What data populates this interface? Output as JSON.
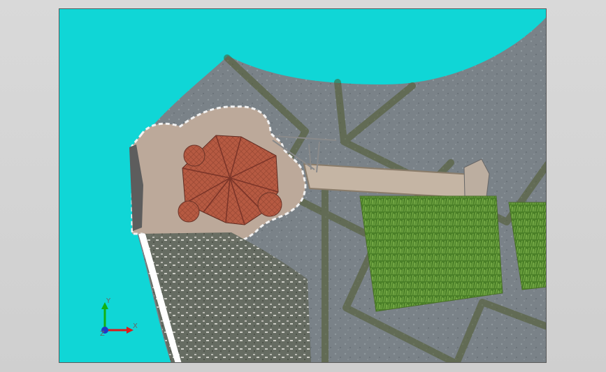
{
  "window": {
    "background_color": "#d8d8d8",
    "viewport_bg": "#10d6d6"
  },
  "triad": {
    "x_label": "X",
    "y_label": "Y",
    "z_label": "Z",
    "x_color": "#dd1a1a",
    "y_color": "#12b112",
    "z_color": "#2038c8"
  },
  "scene": {
    "water_color": "#10d6d6",
    "stone_color": "#777f85",
    "grass_color": "#4f8b2a",
    "roof_color": "#b85b43"
  }
}
